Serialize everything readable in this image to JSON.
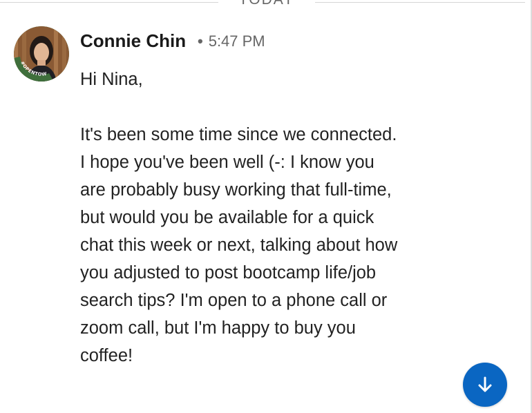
{
  "divider": {
    "label": "TODAY"
  },
  "message": {
    "sender_name": "Connie Chin",
    "separator": "•",
    "timestamp": "5:47 PM",
    "greeting": "Hi Nina,",
    "body": "It's been some time since we connected.\nI hope you've been well (-: I know you\nare probably busy working that full-time,\nbut would you be available for a quick\nchat this week or next, talking about how\nyou adjusted to post bootcamp life/job\nsearch tips? I'm open to a phone call or\nzoom call, but I'm happy to buy you\ncoffee!"
  },
  "avatar": {
    "frame_text": "#OPENTOWORK",
    "frame_color": "#3f6f3c"
  },
  "scroll_button": {
    "icon": "arrow-down-icon",
    "color": "#0a66c2"
  }
}
